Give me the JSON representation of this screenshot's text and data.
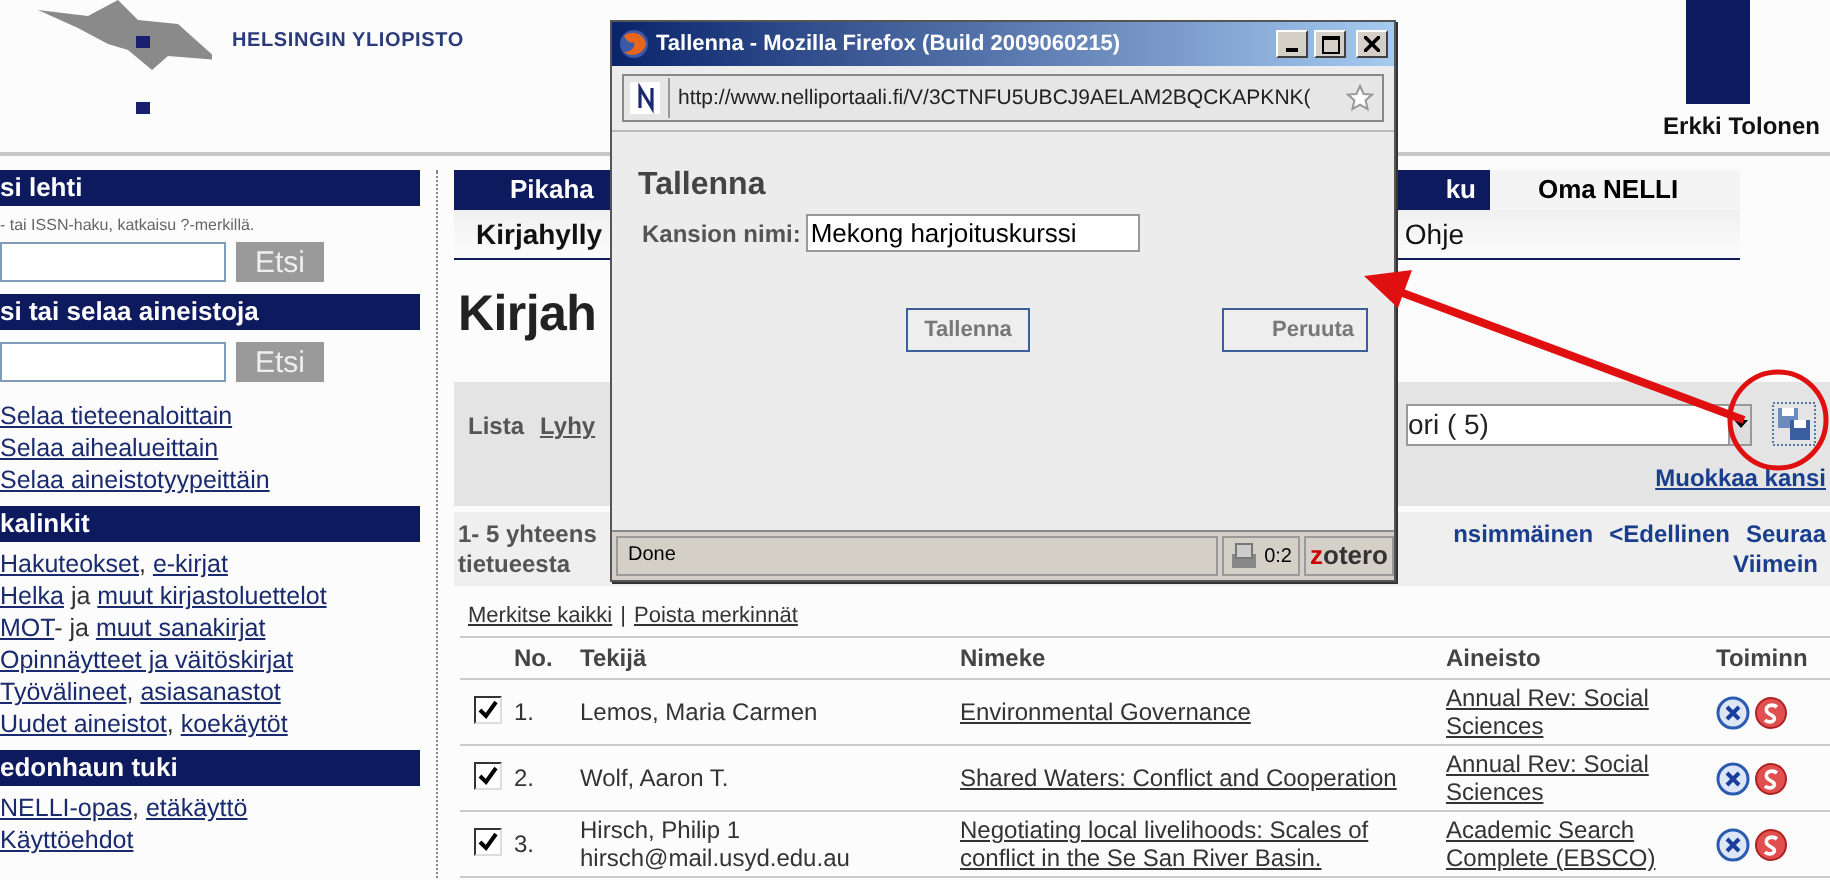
{
  "header": {
    "university": "HELSINGIN YLIOPISTO",
    "user": "Erkki Tolonen"
  },
  "sidebar": {
    "sections": [
      {
        "title": "si lehti",
        "hint": "- tai ISSN-haku, katkaisu ?-merkillä.",
        "search_button": "Etsi"
      },
      {
        "title": "si tai selaa aineistoja",
        "search_button": "Etsi",
        "links": [
          [
            {
              "text": "Selaa tieteenaloittain",
              "kind": "link"
            }
          ],
          [
            {
              "text": "Selaa aihealueittain",
              "kind": "link"
            }
          ],
          [
            {
              "text": "Selaa aineistotyypeittäin",
              "kind": "link"
            }
          ]
        ]
      },
      {
        "title": "kalinkit",
        "links": [
          [
            {
              "text": "Hakuteokset",
              "kind": "link"
            },
            {
              "text": ", ",
              "kind": "text"
            },
            {
              "text": "e-kirjat",
              "kind": "link"
            }
          ],
          [
            {
              "text": "Helka",
              "kind": "link"
            },
            {
              "text": " ja ",
              "kind": "text"
            },
            {
              "text": "muut kirjastoluettelot",
              "kind": "link"
            }
          ],
          [
            {
              "text": "MOT",
              "kind": "link"
            },
            {
              "text": "- ja ",
              "kind": "text"
            },
            {
              "text": "muut sanakirjat",
              "kind": "link"
            }
          ],
          [
            {
              "text": "Opinnäytteet ja väitöskirjat",
              "kind": "link"
            }
          ],
          [
            {
              "text": "Työvälineet",
              "kind": "link"
            },
            {
              "text": ", ",
              "kind": "text"
            },
            {
              "text": "asiasanastot",
              "kind": "link"
            }
          ],
          [
            {
              "text": "Uudet aineistot",
              "kind": "link"
            },
            {
              "text": ", ",
              "kind": "text"
            },
            {
              "text": "koekäytöt",
              "kind": "link"
            }
          ]
        ]
      },
      {
        "title": "edonhaun tuki",
        "links": [
          [
            {
              "text": "NELLI-opas",
              "kind": "link"
            },
            {
              "text": ", ",
              "kind": "text"
            },
            {
              "text": "etäkäyttö",
              "kind": "link"
            }
          ],
          [
            {
              "text": "Käyttöehdot",
              "kind": "link"
            }
          ]
        ]
      }
    ]
  },
  "tabs": [
    {
      "label": "Pikaha",
      "selected": false
    },
    {
      "label": "ku",
      "selected": false
    },
    {
      "label": "Oma NELLI",
      "selected": true
    }
  ],
  "subtabs": [
    {
      "label": "Kirjahylly",
      "selected": true
    },
    {
      "label": "Ohje",
      "selected": false
    }
  ],
  "heading": "Kirjah",
  "view_bar": {
    "label": "Lista",
    "link": "Lyhy",
    "folder_select": "ori ( 5)",
    "edit_link": "Muokkaa kansi"
  },
  "results": {
    "count_line1": "1- 5 yhteens",
    "count_line2": "tietueesta",
    "nav": [
      "nsimmäinen",
      "<Edellinen",
      "Seuraa"
    ],
    "nav_line2": "Viimein"
  },
  "mark_links": {
    "mark_all": "Merkitse kaikki",
    "separator": "|",
    "clear": "Poista merkinnät"
  },
  "table": {
    "columns": [
      "No.",
      "Tekijä",
      "Nimeke",
      "Aineisto",
      "Toiminn"
    ],
    "rows": [
      {
        "checked": true,
        "no": "1.",
        "author": [
          "Lemos, Maria Carmen"
        ],
        "title": "Environmental Governance",
        "source": "Annual Rev: Social Sciences"
      },
      {
        "checked": true,
        "no": "2.",
        "author": [
          "Wolf, Aaron T."
        ],
        "title": "Shared Waters: Conflict and Cooperation",
        "source": "Annual Rev: Social Sciences"
      },
      {
        "checked": true,
        "no": "3.",
        "author": [
          "Hirsch, Philip 1",
          "hirsch@mail.usyd.edu.au"
        ],
        "title": "Negotiating local livelihoods: Scales of conflict in the Se San River Basin.",
        "source": "Academic Search Complete (EBSCO)"
      }
    ]
  },
  "popup": {
    "title": "Tallenna - Mozilla Firefox (Build 2009060215)",
    "url": "http://www.nelliportaali.fi/V/3CTNFU5UBCJ9AELAM2BQCKAPKNK(",
    "heading": "Tallenna",
    "field_label": "Kansion nimi:",
    "field_value": "Mekong harjoituskurssi",
    "buttons": [
      "Tallenna",
      "Peruuta"
    ],
    "status": "Done",
    "counter": "0:2",
    "addon_first": "z",
    "addon_rest": "otero"
  }
}
